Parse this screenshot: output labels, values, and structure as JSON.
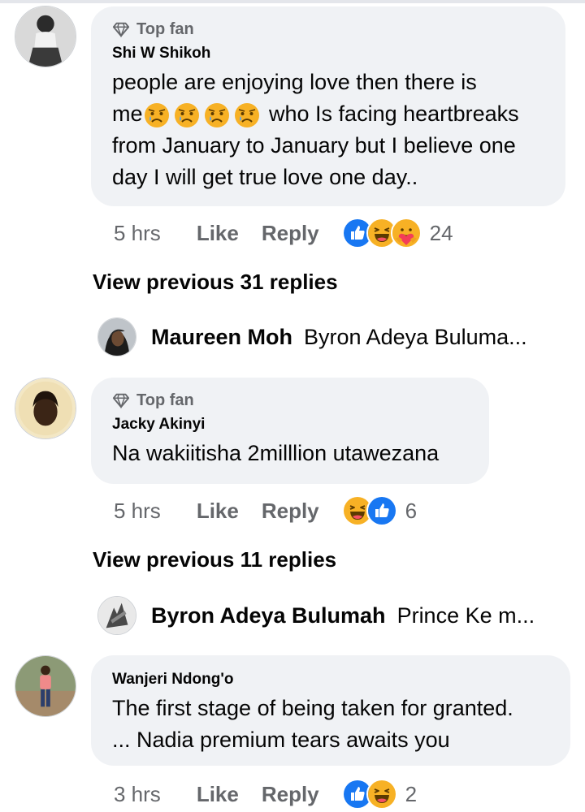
{
  "comments": [
    {
      "badge": "Top fan",
      "author": "Shi W Shikoh",
      "text_1": "people are enjoying love then there is",
      "text_2a": "me",
      "text_2b": " who Is facing heartbreaks",
      "text_3": "from January to January but I believe one",
      "text_4": "day I will get true love one day..",
      "time": "5 hrs",
      "like": "Like",
      "reply": "Reply",
      "reactions": [
        "like",
        "haha",
        "care"
      ],
      "reaction_count": "24",
      "view_previous": "View previous 31 replies",
      "preview": {
        "name": "Maureen Moh",
        "text": "Byron Adeya Buluma..."
      }
    },
    {
      "badge": "Top fan",
      "author": "Jacky Akinyi",
      "text": "Na wakiitisha 2milllion utawezana",
      "time": "5 hrs",
      "like": "Like",
      "reply": "Reply",
      "reactions": [
        "haha",
        "like"
      ],
      "reaction_count": "6",
      "view_previous": "View previous 11 replies",
      "preview": {
        "name": "Byron Adeya Bulumah",
        "text": "Prince Ke  m..."
      }
    },
    {
      "author": "Wanjeri Ndong'o",
      "text_1": "The first stage of being taken  for granted.",
      "text_2": "... Nadia premium tears awaits you",
      "time": "3 hrs",
      "like": "Like",
      "reply": "Reply",
      "reactions": [
        "like",
        "haha"
      ],
      "reaction_count": "2"
    }
  ],
  "colors": {
    "bubble": "#f0f2f5",
    "muted": "#65676b",
    "like_blue": "#1877f2",
    "haha_yellow": "#f7b125"
  }
}
